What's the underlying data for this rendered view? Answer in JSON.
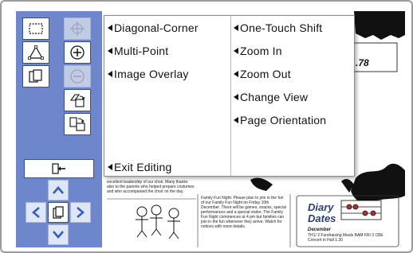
{
  "menu": {
    "left_items": [
      {
        "label": "Diagonal-Corner"
      },
      {
        "label": "Multi-Point"
      },
      {
        "label": "Image Overlay"
      }
    ],
    "right_items": [
      {
        "label": "One-Touch Shift"
      },
      {
        "label": "Zoom In"
      },
      {
        "label": "Zoom Out"
      },
      {
        "label": "Change View"
      },
      {
        "label": "Page Orientation"
      }
    ],
    "exit_label": "Exit Editing"
  },
  "document": {
    "price_text": ".78",
    "left_paragraph": "excellent leadership of our choir. Many thanks also to the parents who helped prepare costumes and who accompanied the choir on the day.",
    "notice_paragraph": "Family Fun Night: Please plan to join in the fun of our Family Fun Night on Friday 10th December. There will be games, snacks, special performances and a special visitor. The Family Fun Night commences at 4 pm but families can join in the fun whenever they arrive. Watch for notices with more details.",
    "diary_title": "Diary Dates",
    "diary_subtitle": "December",
    "diary_lines": "TH1/ 2 Fundraising Meals BAM FRI 3 CBE Concert in Hall 1.30"
  },
  "colors": {
    "panel": "#6e86cc",
    "arrow_blue": "#2f5fbf"
  }
}
